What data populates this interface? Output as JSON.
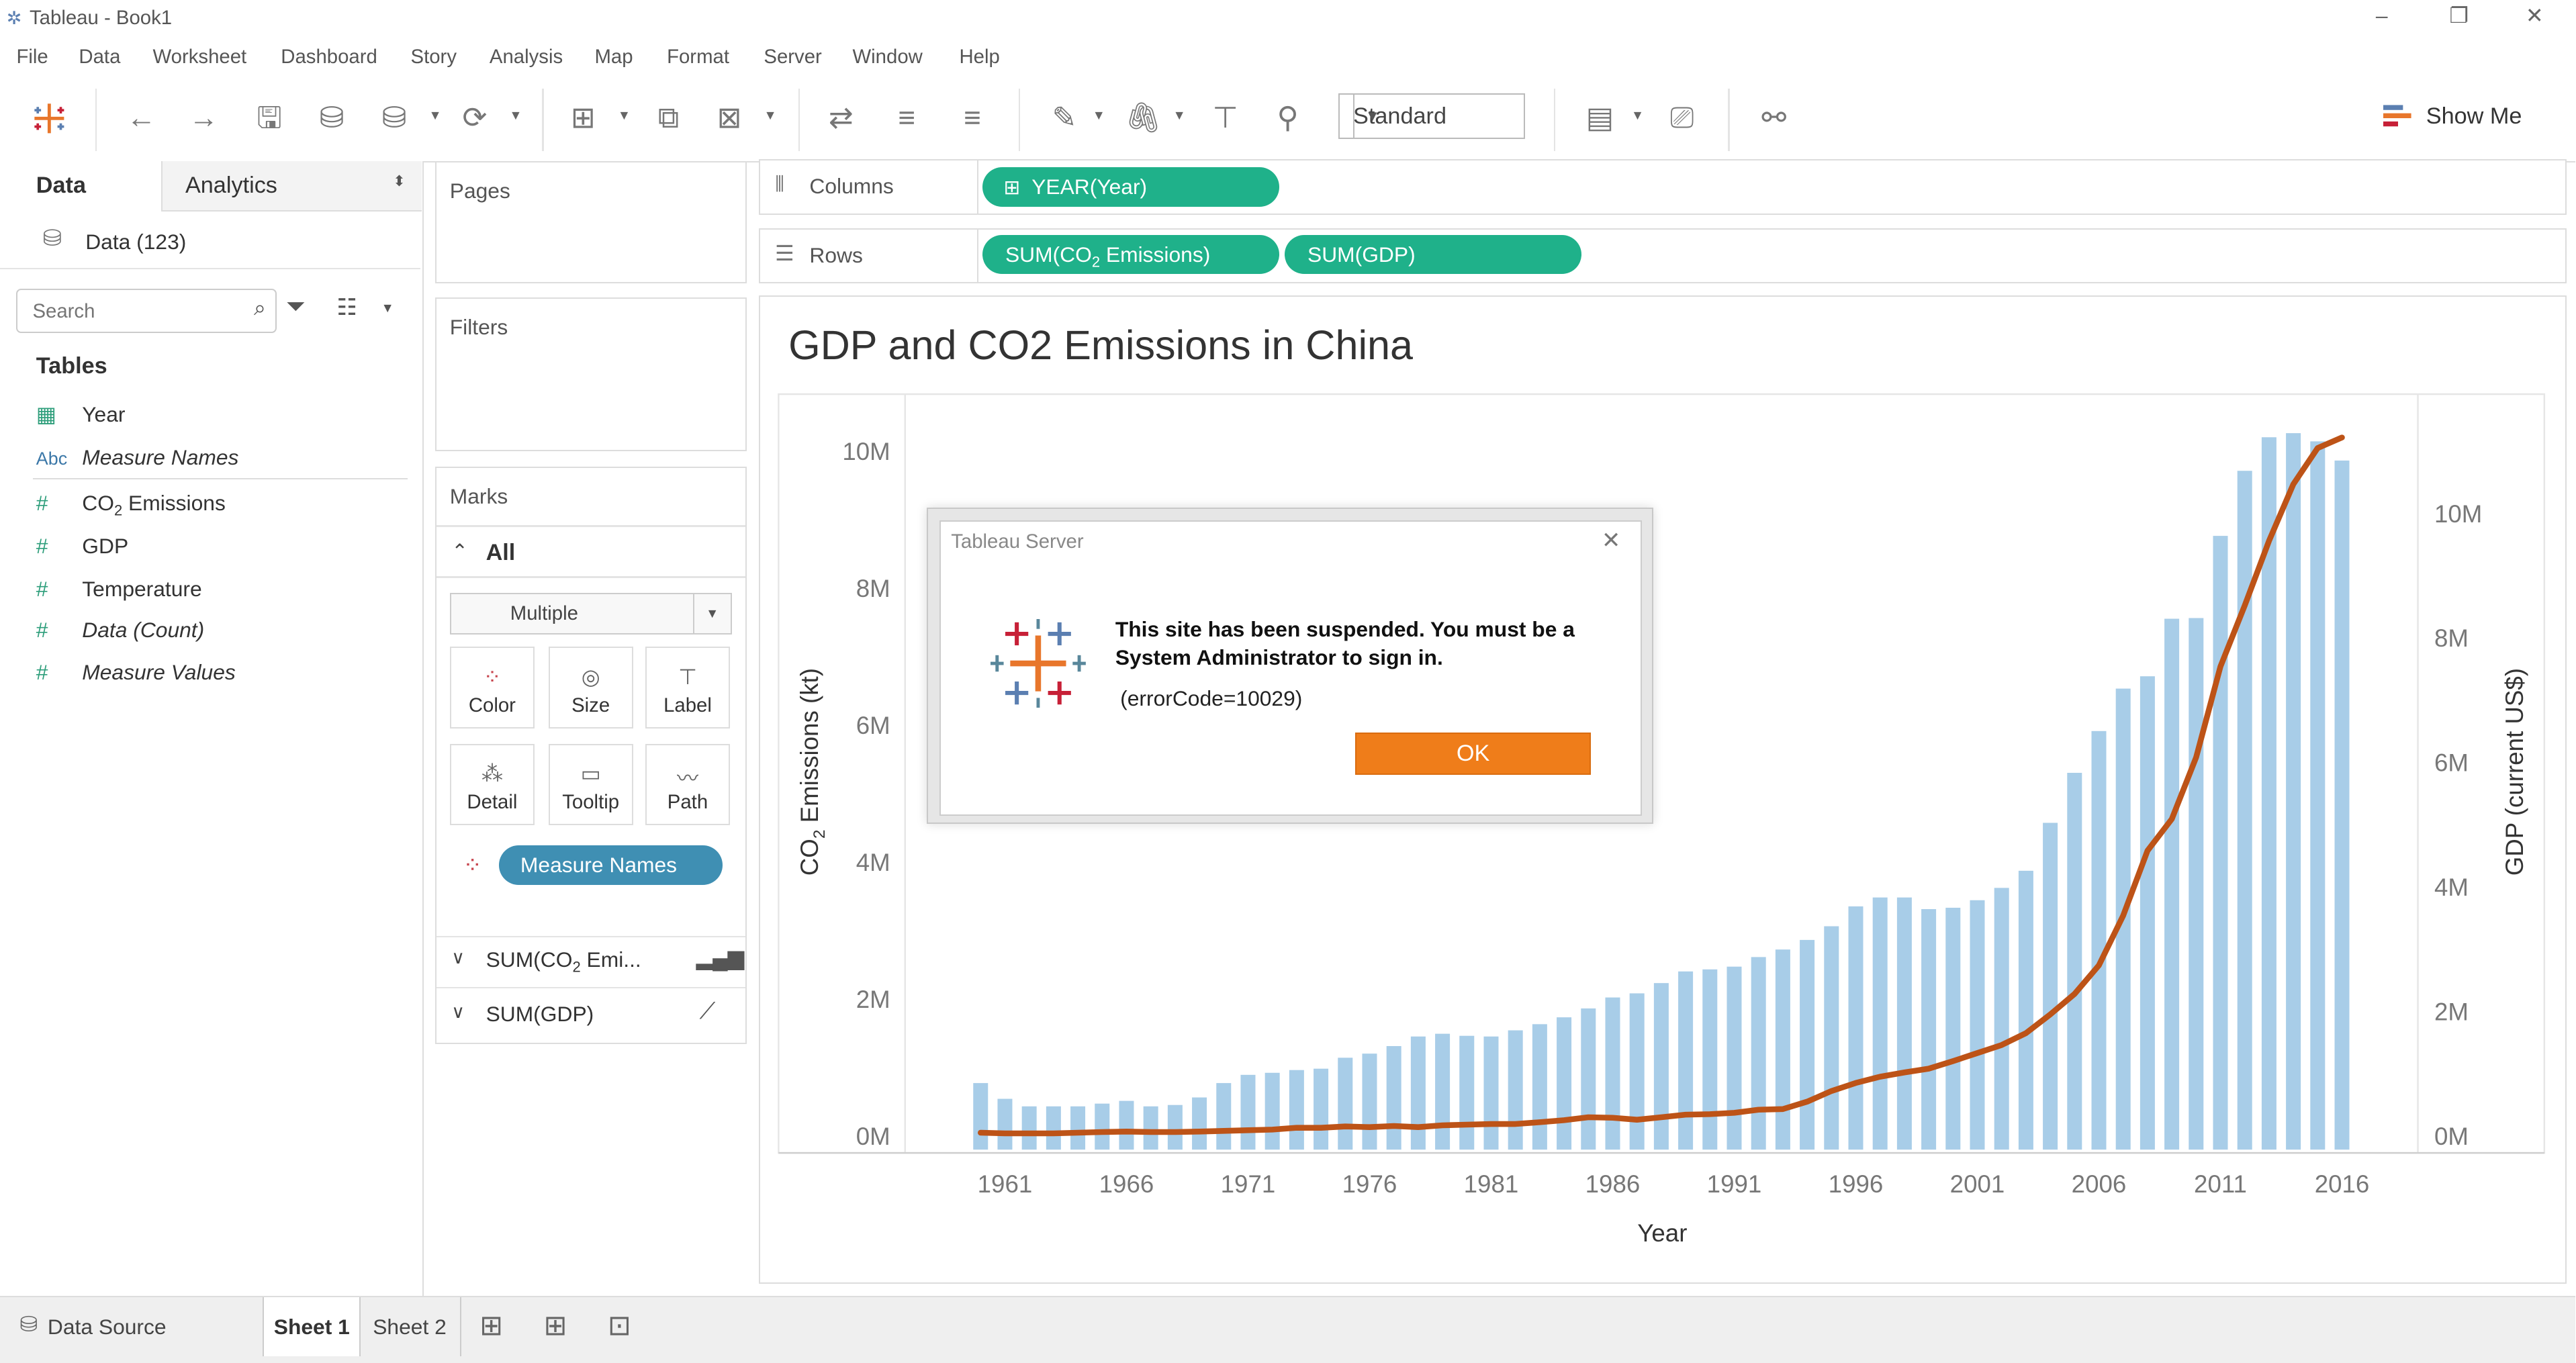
{
  "window": {
    "title": "Tableau - Book1"
  },
  "menu": [
    "File",
    "Data",
    "Worksheet",
    "Dashboard",
    "Story",
    "Analysis",
    "Map",
    "Format",
    "Server",
    "Window",
    "Help"
  ],
  "toolbar": {
    "fit_select": "Standard",
    "show_me": "Show Me"
  },
  "left_panel": {
    "tab_data": "Data",
    "tab_analytics": "Analytics",
    "datasource": "Data (123)",
    "search_placeholder": "Search",
    "tables_heading": "Tables",
    "fields": [
      {
        "name": "Year",
        "type": "date"
      },
      {
        "name": "Measure Names",
        "type": "abc"
      },
      {
        "name": "CO2 Emissions",
        "type": "measure"
      },
      {
        "name": "GDP",
        "type": "measure"
      },
      {
        "name": "Temperature",
        "type": "measure"
      },
      {
        "name": "Data (Count)",
        "type": "measure"
      },
      {
        "name": "Measure Values",
        "type": "measure"
      }
    ]
  },
  "cards": {
    "pages": "Pages",
    "filters": "Filters",
    "marks": "Marks",
    "marks_all": "All",
    "mark_type": "Multiple",
    "buttons": [
      "Color",
      "Size",
      "Label",
      "Detail",
      "Tooltip",
      "Path"
    ],
    "measure_names_pill": "Measure Names",
    "sub_marks": [
      "SUM(CO2 Emi...",
      "SUM(GDP)"
    ]
  },
  "shelves": {
    "columns_label": "Columns",
    "rows_label": "Rows",
    "columns_pills": [
      "YEAR(Year)"
    ],
    "rows_pills": [
      "SUM(CO2 Emissions)",
      "SUM(GDP)"
    ]
  },
  "sheet": {
    "title": "GDP and CO2 Emissions in China"
  },
  "dialog": {
    "title": "Tableau Server",
    "message": "This site has been suspended. You must be a System Administrator to sign in.",
    "code": "(errorCode=10029)",
    "ok": "OK"
  },
  "bottom": {
    "data_source": "Data Source",
    "tabs": [
      "Sheet 1",
      "Sheet 2"
    ]
  },
  "chart_data": {
    "type": "bar",
    "title": "GDP and CO2 Emissions in China",
    "xlabel": "Year",
    "ylabel": "CO2 Emissions (kt)",
    "y2label": "GDP (current US$)",
    "x_tick_labels": [
      "1961",
      "1966",
      "1971",
      "1976",
      "1981",
      "1986",
      "1991",
      "1996",
      "2001",
      "2006",
      "2011",
      "2016"
    ],
    "y_tick_labels": [
      "0M",
      "2M",
      "4M",
      "6M",
      "8M",
      "10M"
    ],
    "y2_tick_labels": [
      "0M",
      "2M",
      "4M",
      "6M",
      "8M",
      "10M"
    ],
    "ylim": [
      0,
      10.5
    ],
    "y2lim": [
      0,
      11.7
    ],
    "years": [
      1960,
      1961,
      1962,
      1963,
      1964,
      1965,
      1966,
      1967,
      1968,
      1969,
      1970,
      1971,
      1972,
      1973,
      1974,
      1975,
      1976,
      1977,
      1978,
      1979,
      1980,
      1981,
      1982,
      1983,
      1984,
      1985,
      1986,
      1987,
      1988,
      1989,
      1990,
      1991,
      1992,
      1993,
      1994,
      1995,
      1996,
      1997,
      1998,
      1999,
      2000,
      2001,
      2002,
      2003,
      2004,
      2005,
      2006,
      2007,
      2008,
      2009,
      2010,
      2011,
      2012,
      2013,
      2014,
      2015,
      2016
    ],
    "series": [
      {
        "name": "SUM(CO2 Emissions)",
        "kind": "bar",
        "color": "#a8cde8",
        "values": [
          0.78,
          0.55,
          0.44,
          0.44,
          0.44,
          0.48,
          0.52,
          0.44,
          0.46,
          0.57,
          0.78,
          0.9,
          0.93,
          0.97,
          0.99,
          1.15,
          1.21,
          1.32,
          1.46,
          1.5,
          1.47,
          1.46,
          1.55,
          1.64,
          1.74,
          1.87,
          2.03,
          2.09,
          2.24,
          2.41,
          2.44,
          2.48,
          2.62,
          2.73,
          2.87,
          3.07,
          3.36,
          3.49,
          3.49,
          3.32,
          3.34,
          3.45,
          3.63,
          3.88,
          4.58,
          5.31,
          5.92,
          6.54,
          6.72,
          7.56,
          7.57,
          8.77,
          9.72,
          10.21,
          10.27,
          10.15,
          9.87
        ]
      },
      {
        "name": "SUM(GDP)",
        "kind": "line",
        "color": "#bd5317",
        "values": [
          0.06,
          0.05,
          0.05,
          0.05,
          0.06,
          0.07,
          0.08,
          0.07,
          0.07,
          0.08,
          0.09,
          0.1,
          0.11,
          0.14,
          0.14,
          0.16,
          0.15,
          0.17,
          0.15,
          0.18,
          0.19,
          0.2,
          0.2,
          0.23,
          0.26,
          0.31,
          0.3,
          0.27,
          0.31,
          0.35,
          0.36,
          0.38,
          0.43,
          0.44,
          0.56,
          0.73,
          0.86,
          0.96,
          1.03,
          1.09,
          1.21,
          1.34,
          1.47,
          1.66,
          1.96,
          2.29,
          2.75,
          3.55,
          4.59,
          5.1,
          6.09,
          7.55,
          8.53,
          9.57,
          10.48,
          11.06,
          11.23
        ]
      }
    ]
  }
}
